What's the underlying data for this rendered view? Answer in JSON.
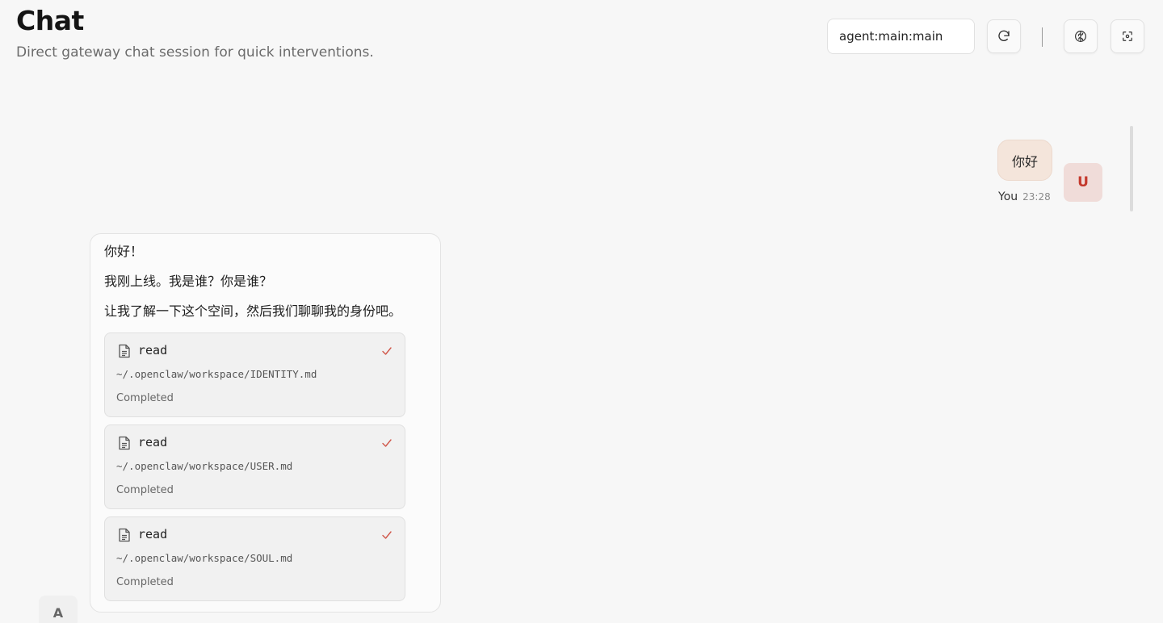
{
  "header": {
    "title": "Chat",
    "subtitle": "Direct gateway chat session for quick interventions.",
    "session_value": "agent:main:main",
    "refresh_icon": "refresh-icon",
    "thinking_icon": "brain-icon",
    "focus_icon": "focus-icon"
  },
  "messages": {
    "user": {
      "text": "你好",
      "sender": "You",
      "time": "23:28",
      "avatar_letter": "U"
    },
    "assistant": {
      "lines": [
        "你好！",
        "我刚上线。我是谁？你是谁？",
        "让我了解一下这个空间，然后我们聊聊我的身份吧。"
      ],
      "avatar_letter": "A",
      "tools": [
        {
          "name": "read",
          "path": "~/.openclaw/workspace/IDENTITY.md",
          "status": "Completed"
        },
        {
          "name": "read",
          "path": "~/.openclaw/workspace/USER.md",
          "status": "Completed"
        },
        {
          "name": "read",
          "path": "~/.openclaw/workspace/SOUL.md",
          "status": "Completed"
        }
      ]
    }
  },
  "colors": {
    "accent": "#c4392d",
    "user_bubble": "#f4e5db",
    "background": "#f7f7f7"
  }
}
